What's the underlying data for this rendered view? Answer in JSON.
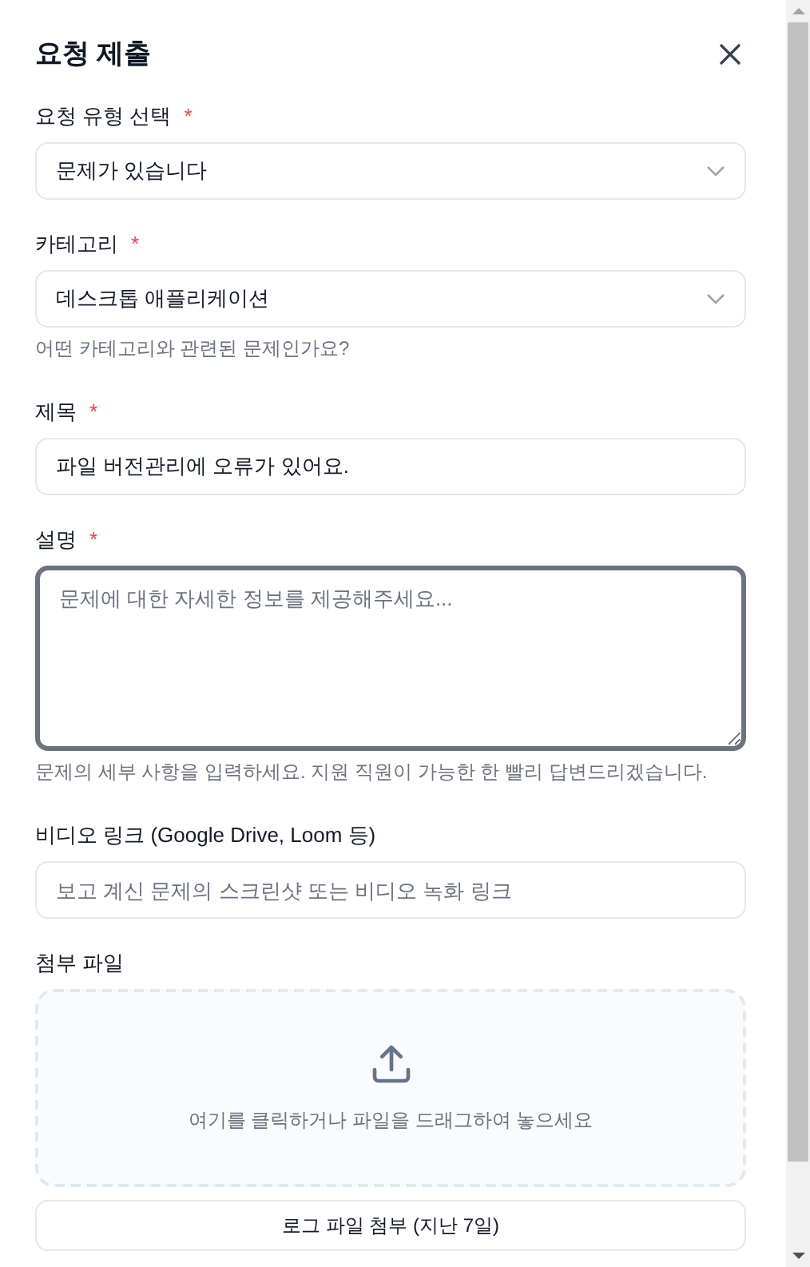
{
  "dialog": {
    "title": "요청 제출"
  },
  "fields": [
    {
      "kind": "select",
      "label": "요청 유형 선택",
      "required_mark": "*",
      "value": "문제가 있습니다"
    },
    {
      "kind": "select",
      "label": "카테고리",
      "required_mark": "*",
      "value": "데스크톱 애플리케이션",
      "hint": "어떤 카테고리와 관련된 문제인가요?"
    },
    {
      "kind": "input",
      "label": "제목",
      "required_mark": "*",
      "value": "파일 버전관리에 오류가 있어요."
    },
    {
      "kind": "textarea",
      "label": "설명",
      "required_mark": "*",
      "placeholder": "문제에 대한 자세한 정보를 제공해주세요...",
      "focused": true,
      "hint": "문제의 세부 사항을 입력하세요. 지원 직원이 가능한 한 빨리 답변드리겠습니다."
    },
    {
      "kind": "input",
      "label": "비디오 링크 (Google Drive, Loom 등)",
      "placeholder": "보고 계신 문제의 스크린샷 또는 비디오 녹화 링크"
    },
    {
      "kind": "dropzone",
      "label": "첨부 파일",
      "text": "여기를 클릭하거나 파일을 드래그하여 놓으세요"
    }
  ],
  "buttons": [
    "로그 파일 첨부 (지난 7일)"
  ]
}
